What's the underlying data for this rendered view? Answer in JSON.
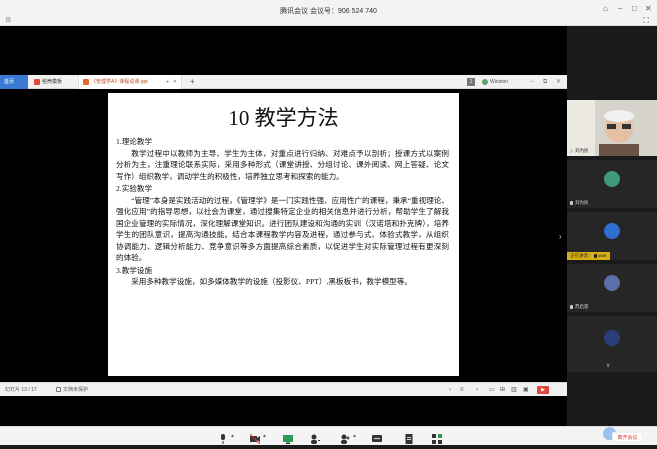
{
  "window": {
    "title": "腾讯会议 会议号：906 524 740"
  },
  "tabs": [
    {
      "label": "首页"
    },
    {
      "label": "稻壳模板"
    },
    {
      "label": "《管理学A》课程说课.ppt"
    }
  ],
  "tabbar_right": {
    "badge": "1",
    "user": "Winston"
  },
  "slide": {
    "title": "10 教学方法",
    "sections": [
      {
        "heading": "1.理论教学",
        "text": "教学过程中以教师为主导、学生为主体，对重点进行归纳、对难点予以剖析；授课方式以案例分析为主，注重理论联系实际，采用多种形式（课堂讲授、分组讨论、课外阅读、网上答疑、论文写作）组织教学，调动学生的积极性，培养独立思考和探索的能力。"
      },
      {
        "heading": "2.实验教学",
        "text": "“管理”本身是实践活动的过程，《管理学》是一门实践性强、应用性广的课程，秉承“重视理论、强化应用”的指导思想，以社会为课堂，通过搜集特定企业的相关信息并进行分析，帮助学生了解我国企业管理的实际情况，深化理解课堂知识。进行团队建设和沟通的实训（汉诺塔和扑克牌），培养学生的团队意识，提高沟通技能。结合本课程教学内容及进程，通过参与式、体验式教学，从组织协调能力、逻辑分析能力、竞争意识等多方面提高综合素质，以促进学生对实际管理过程有更深刻的体验。"
      },
      {
        "heading": "3.教学设施",
        "text": "采用多种教学设施，如多媒体教学的设施（投影仪、PPT）,黑板板书，教学模型等。"
      }
    ]
  },
  "statusbar": {
    "page": "幻灯片 13 / 17",
    "protect": "文档未保护"
  },
  "participants": [
    {
      "name": "刘为民",
      "kind": "video"
    },
    {
      "name": "刘为民",
      "kind": "avatar",
      "color": "#3d9a7a"
    },
    {
      "name": "user",
      "kind": "avatar",
      "color": "#2f6fd1",
      "speaking_label": "正在讲话："
    },
    {
      "name": "苏启容",
      "kind": "avatar",
      "color": "#5b6fa8"
    }
  ],
  "panel_more": "∨",
  "bottombar": {
    "leave_label": "离开会议"
  },
  "colors": {
    "accent_blue": "#3a7bd5",
    "play_red": "#e0483e",
    "speaking_yellow": "#d7b016",
    "leave_red": "#dd3333"
  }
}
